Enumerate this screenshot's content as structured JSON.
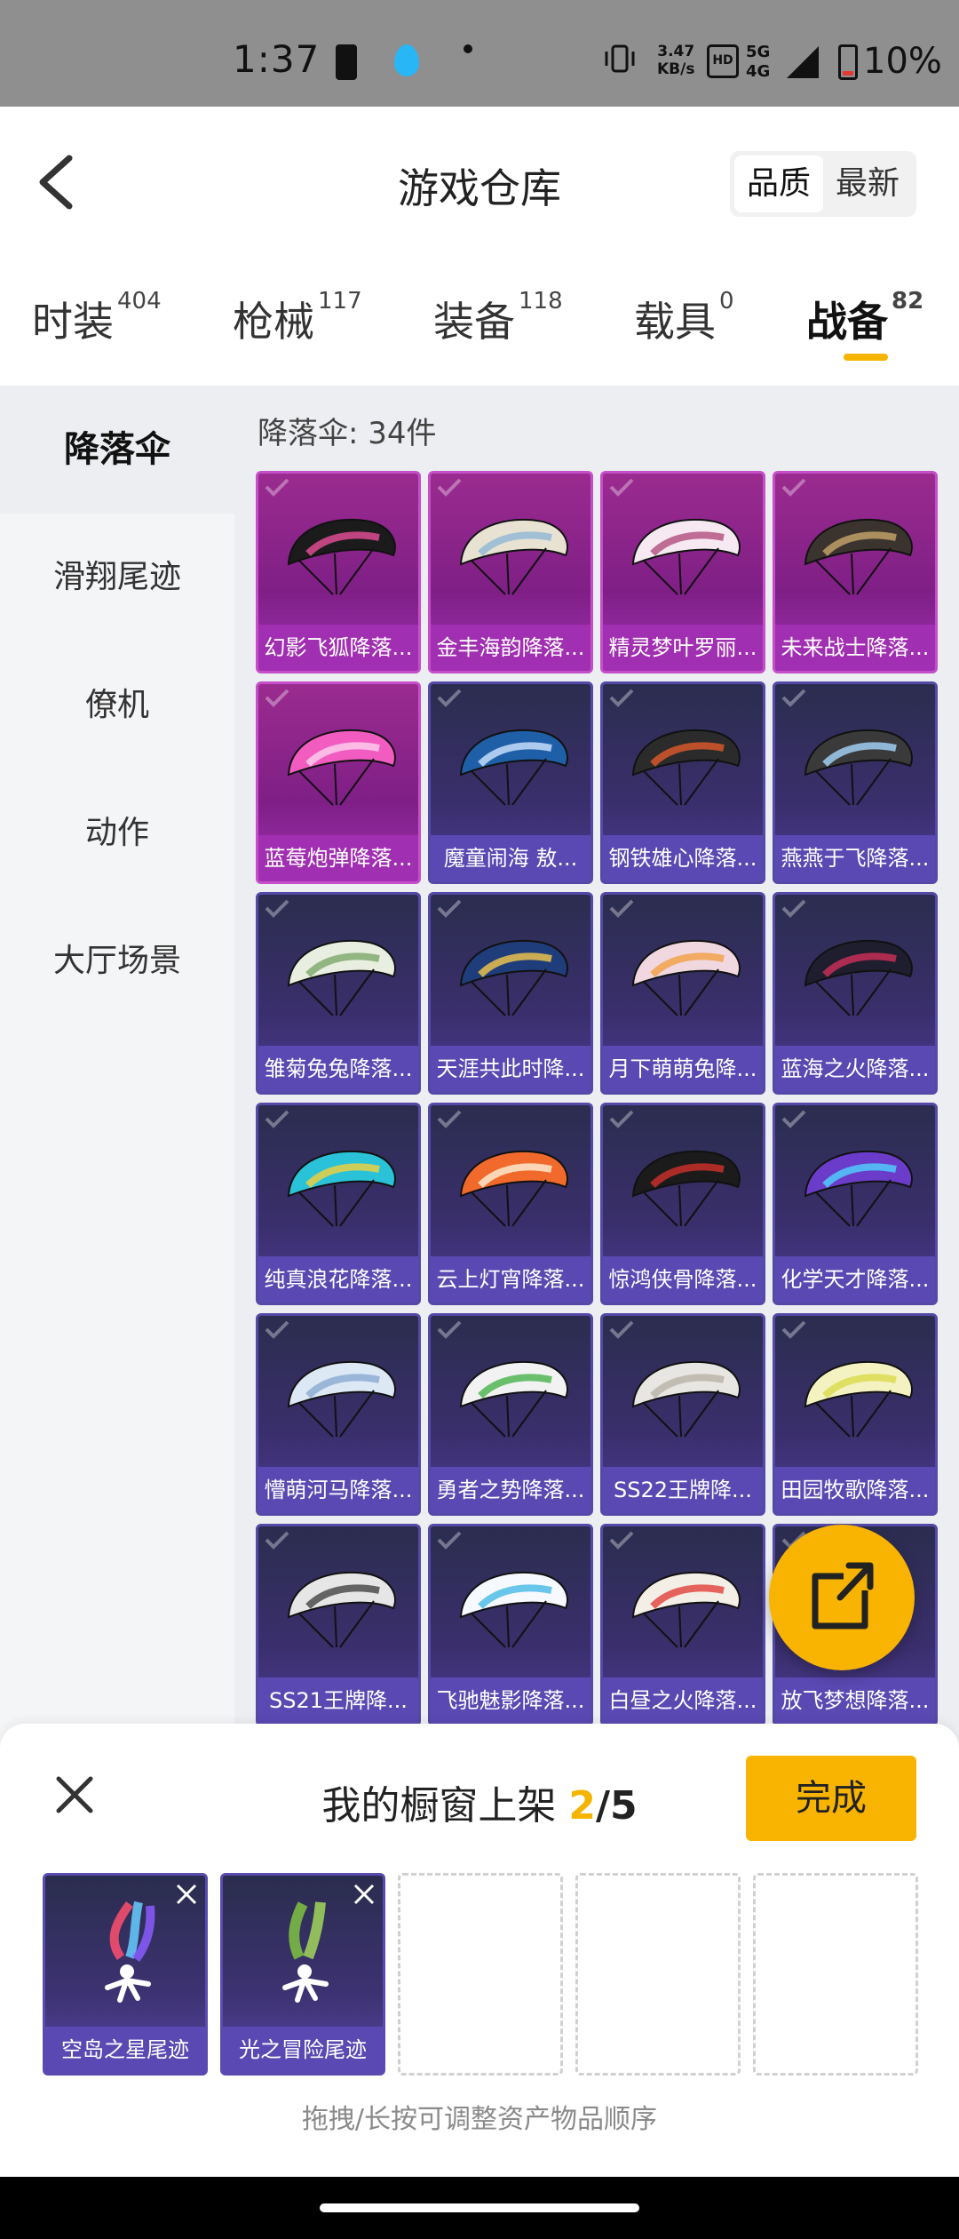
{
  "status_bar": {
    "time": "1:37",
    "net_speed_value": "3.47",
    "net_speed_unit": "KB/s",
    "hd_label": "HD",
    "network_top": "5G",
    "network_bottom": "4G",
    "battery_pct": "10%"
  },
  "header": {
    "title": "游戏仓库",
    "sort_quality": "品质",
    "sort_newest": "最新"
  },
  "tabs": [
    {
      "label": "时装",
      "count": "404"
    },
    {
      "label": "枪械",
      "count": "117"
    },
    {
      "label": "装备",
      "count": "118"
    },
    {
      "label": "载具",
      "count": "0"
    },
    {
      "label": "战备",
      "count": "82"
    }
  ],
  "sidebar": {
    "items": [
      "降落伞",
      "滑翔尾迹",
      "僚机",
      "动作",
      "大厅场景"
    ]
  },
  "section": {
    "count_text": "降落伞: 34件"
  },
  "colors": {
    "accent": "#f8b400",
    "purple_card": "#a12fb1",
    "blue_card": "#5a49b2"
  },
  "items": [
    {
      "name": "幻影飞狐降落...",
      "rarity": "purple"
    },
    {
      "name": "金丰海韵降落...",
      "rarity": "purple"
    },
    {
      "name": "精灵梦叶罗丽...",
      "rarity": "purple"
    },
    {
      "name": "未来战士降落...",
      "rarity": "purple"
    },
    {
      "name": "蓝莓炮弹降落...",
      "rarity": "purple"
    },
    {
      "name": "魔童闹海 敖...",
      "rarity": "blue"
    },
    {
      "name": "钢铁雄心降落...",
      "rarity": "blue"
    },
    {
      "name": "燕燕于飞降落...",
      "rarity": "blue"
    },
    {
      "name": "雏菊兔兔降落...",
      "rarity": "blue"
    },
    {
      "name": "天涯共此时降...",
      "rarity": "blue"
    },
    {
      "name": "月下萌萌兔降...",
      "rarity": "blue"
    },
    {
      "name": "蓝海之火降落...",
      "rarity": "blue"
    },
    {
      "name": "纯真浪花降落...",
      "rarity": "blue"
    },
    {
      "name": "云上灯宵降落...",
      "rarity": "blue"
    },
    {
      "name": "惊鸿侠骨降落...",
      "rarity": "blue"
    },
    {
      "name": "化学天才降落...",
      "rarity": "blue"
    },
    {
      "name": "懵萌河马降落...",
      "rarity": "blue"
    },
    {
      "name": "勇者之势降落...",
      "rarity": "blue"
    },
    {
      "name": "SS22王牌降...",
      "rarity": "blue"
    },
    {
      "name": "田园牧歌降落...",
      "rarity": "blue"
    },
    {
      "name": "SS21王牌降...",
      "rarity": "blue"
    },
    {
      "name": "飞驰魅影降落...",
      "rarity": "blue"
    },
    {
      "name": "白昼之火降落...",
      "rarity": "blue"
    },
    {
      "name": "放飞梦想降落...",
      "rarity": "blue"
    }
  ],
  "showcase": {
    "title": "我的橱窗上架",
    "current": "2",
    "total": "/5",
    "done_label": "完成",
    "slots": [
      "空岛之星尾迹",
      "光之冒险尾迹"
    ],
    "hint": "拖拽/长按可调整资产物品顺序"
  }
}
